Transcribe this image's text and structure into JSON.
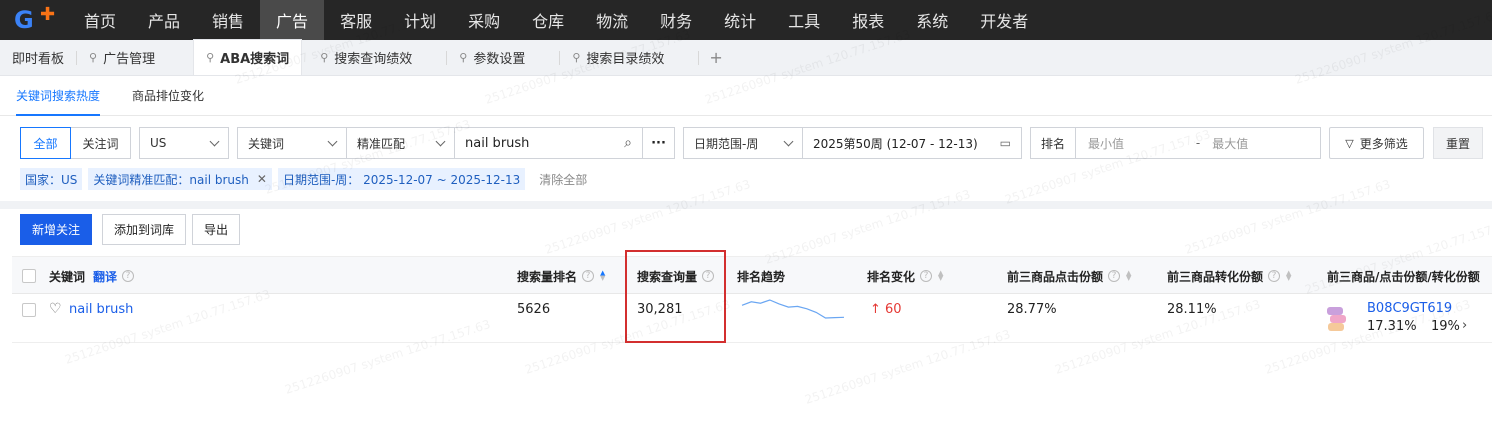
{
  "nav": {
    "logo_text": "G",
    "items": [
      "首页",
      "产品",
      "销售",
      "广告",
      "客服",
      "计划",
      "采购",
      "仓库",
      "物流",
      "财务",
      "统计",
      "工具",
      "报表",
      "系统",
      "开发者"
    ],
    "active_index": 3
  },
  "tabs": {
    "items": [
      {
        "label": "即时看板",
        "pinned": false
      },
      {
        "label": "广告管理",
        "pinned": true
      },
      {
        "label": "ABA搜索词",
        "pinned": true,
        "active": true
      },
      {
        "label": "搜索查询绩效",
        "pinned": true
      },
      {
        "label": "参数设置",
        "pinned": true
      },
      {
        "label": "搜索目录绩效",
        "pinned": true
      }
    ],
    "add_label": "+"
  },
  "subtabs": [
    "关键词搜索热度",
    "商品排位变化"
  ],
  "filters": {
    "all_label": "全部",
    "follow_label": "关注词",
    "country": "US",
    "keyword_type": "关键词",
    "match_type": "精准匹配",
    "search_value": "nail brush",
    "more_icon": "···",
    "date_type": "日期范围-周",
    "date_value": "2025第50周 (12-07 - 12-13)",
    "rank_label": "排名",
    "rank_min_placeholder": "最小值",
    "rank_sep": "-",
    "rank_max_placeholder": "最大值",
    "more_filters": "更多筛选",
    "reset": "重置"
  },
  "chips": {
    "country": "国家：US",
    "match": "关键词精准匹配：nail brush",
    "date": "日期范围-周：  2025-12-07 ~ 2025-12-13",
    "clear_all": "清除全部"
  },
  "actions": {
    "add_follow": "新增关注",
    "add_to_lib": "添加到词库",
    "export": "导出"
  },
  "table": {
    "headers": {
      "keyword": "关键词",
      "translate": "翻译",
      "search_rank": "搜索量排名",
      "search_volume": "搜索查询量",
      "rank_trend": "排名趋势",
      "rank_change": "排名变化",
      "top3_click": "前三商品点击份额",
      "top3_conv": "前三商品转化份额",
      "top3_detail": "前三商品/点击份额/转化份额"
    },
    "rows": [
      {
        "keyword": "nail brush",
        "search_rank": "5626",
        "search_volume": "30,281",
        "rank_change": "↑ 60",
        "top3_click": "28.77%",
        "top3_conv": "28.11%",
        "asin": "B08C9GT619",
        "asin_click": "17.31%",
        "asin_conv": "19%"
      }
    ]
  },
  "trend_points": [
    5680,
    5660,
    5668,
    5650,
    5672,
    5690,
    5686,
    5700,
    5720,
    5752,
    5750,
    5748
  ],
  "watermark": "2512260907 system 120.77.157.63",
  "colors": {
    "nav_bg": "#262626",
    "primary": "#1a5ee8",
    "highlight": "#d32f2f",
    "rank_up": "#e53935"
  }
}
